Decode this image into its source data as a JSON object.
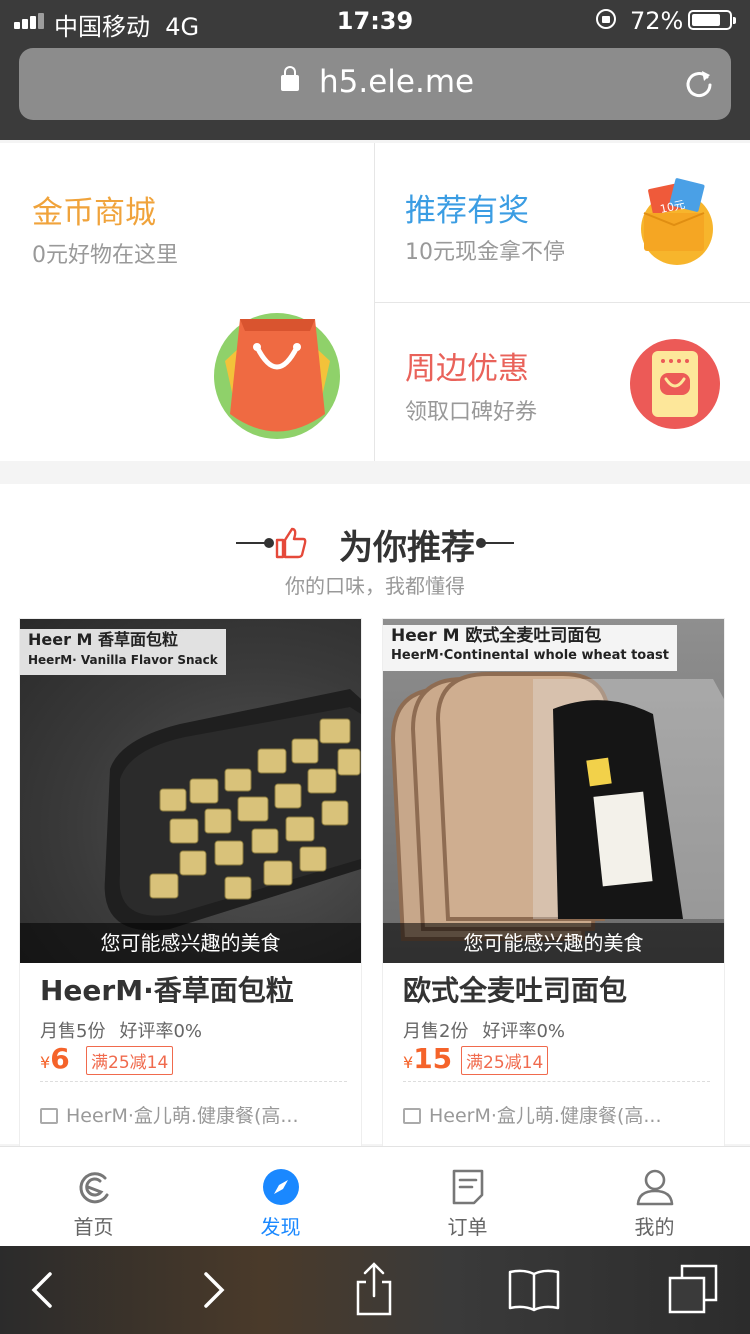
{
  "status_bar": {
    "carrier": "中国移动",
    "network": "4G",
    "time": "17:39",
    "battery": "72%"
  },
  "browser": {
    "url": "h5.ele.me"
  },
  "promo": {
    "coins": {
      "title": "金币商城",
      "subtitle": "0元好物在这里",
      "color": "#f0a33b"
    },
    "refer": {
      "title": "推荐有奖",
      "subtitle": "10元现金拿不停",
      "color": "#3b9de3"
    },
    "nearby": {
      "title": "周边优惠",
      "subtitle": "领取口碑好券",
      "color": "#e9625a"
    },
    "coupon_label": "10元"
  },
  "recommend": {
    "title": "为你推荐",
    "subtitle": "你的口味，我都懂得",
    "items": [
      {
        "banner_title": "Heer M 香草面包粒",
        "banner_sub": "HeerM· Vanilla Flavor Snack",
        "caption": "您可能感兴趣的美食",
        "name": "HeerM·香草面包粒",
        "monthly_sales": "月售5份",
        "rating": "好评率0%",
        "currency": "¥",
        "price": "6",
        "discount": "满25减14",
        "shop": "HeerM·盒儿萌.健康餐(高..."
      },
      {
        "banner_title": "Heer M 欧式全麦吐司面包",
        "banner_sub": "HeerM·Continental whole wheat toast",
        "caption": "您可能感兴趣的美食",
        "name": "欧式全麦吐司面包",
        "monthly_sales": "月售2份",
        "rating": "好评率0%",
        "currency": "¥",
        "price": "15",
        "discount": "满25减14",
        "shop": "HeerM·盒儿萌.健康餐(高..."
      }
    ]
  },
  "tabbar": {
    "items": [
      {
        "label": "首页",
        "icon": "eleme-logo-icon"
      },
      {
        "label": "发现",
        "icon": "compass-icon",
        "active": true
      },
      {
        "label": "订单",
        "icon": "order-icon"
      },
      {
        "label": "我的",
        "icon": "profile-icon"
      }
    ]
  },
  "toolbar": {
    "icons": [
      "back-icon",
      "forward-icon",
      "share-icon",
      "bookmarks-icon",
      "tabs-icon"
    ]
  }
}
